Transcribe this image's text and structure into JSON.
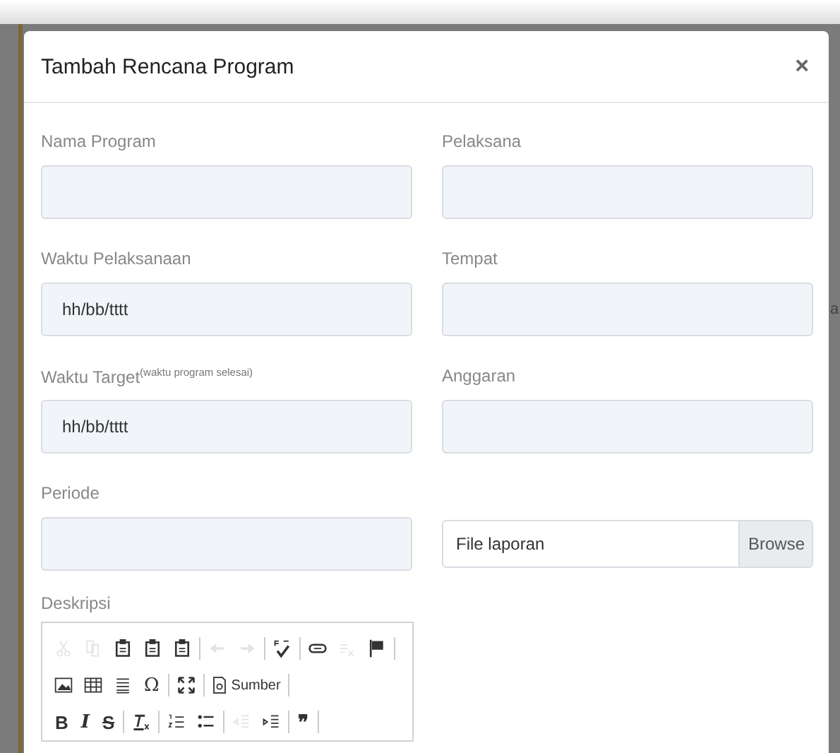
{
  "backdrop": {
    "text_fragment": "a"
  },
  "modal": {
    "title": "Tambah Rencana Program",
    "close": "×"
  },
  "fields": [
    {
      "label": "Nama Program",
      "kind": "text"
    },
    {
      "label": "Pelaksana",
      "kind": "text"
    },
    {
      "label": "Waktu Pelaksanaan",
      "kind": "date",
      "placeholder": "hh/bb/tttt"
    },
    {
      "label": "Tempat",
      "kind": "text"
    },
    {
      "label": "Waktu Target",
      "note": "(waktu program selesai)",
      "kind": "date",
      "placeholder": "hh/bb/tttt"
    },
    {
      "label": "Anggaran",
      "kind": "text"
    },
    {
      "label": "Periode",
      "kind": "text"
    },
    {
      "kind": "file",
      "placeholder": "File laporan",
      "button": "Browse"
    }
  ],
  "description": {
    "label": "Deskripsi",
    "toolbar": [
      [
        {
          "kind": "cut",
          "disabled": true
        },
        {
          "kind": "copy",
          "disabled": true
        },
        {
          "kind": "paste",
          "disabled": false
        },
        {
          "kind": "paste-text",
          "disabled": false
        },
        {
          "kind": "paste-word",
          "disabled": false
        },
        {
          "kind": "sep"
        },
        {
          "kind": "undo",
          "disabled": true
        },
        {
          "kind": "redo",
          "disabled": true
        },
        {
          "kind": "sep"
        },
        {
          "kind": "spell",
          "disabled": false
        },
        {
          "kind": "sep"
        },
        {
          "kind": "link",
          "disabled": false
        },
        {
          "kind": "unlink",
          "disabled": true
        },
        {
          "kind": "flag",
          "disabled": false
        },
        {
          "kind": "sep"
        }
      ],
      [
        {
          "kind": "image",
          "disabled": false
        },
        {
          "kind": "table",
          "disabled": false
        },
        {
          "kind": "hr",
          "disabled": false
        },
        {
          "kind": "char",
          "label": "Ω",
          "disabled": false
        },
        {
          "kind": "sep"
        },
        {
          "kind": "maximize",
          "disabled": false
        },
        {
          "kind": "sep"
        },
        {
          "kind": "source",
          "label": "Sumber",
          "disabled": false
        },
        {
          "kind": "sep"
        }
      ],
      [
        {
          "kind": "bold",
          "label": "B",
          "disabled": false
        },
        {
          "kind": "italic",
          "label": "I",
          "disabled": false
        },
        {
          "kind": "strike",
          "label": "S",
          "disabled": false
        },
        {
          "kind": "sep"
        },
        {
          "kind": "clear-format",
          "disabled": false
        },
        {
          "kind": "sep"
        },
        {
          "kind": "ol",
          "disabled": false
        },
        {
          "kind": "ul",
          "disabled": false
        },
        {
          "kind": "sep"
        },
        {
          "kind": "outdent",
          "disabled": true
        },
        {
          "kind": "indent",
          "disabled": false
        },
        {
          "kind": "sep"
        },
        {
          "kind": "quote",
          "label": "❞",
          "disabled": false
        },
        {
          "kind": "sep"
        }
      ]
    ]
  }
}
